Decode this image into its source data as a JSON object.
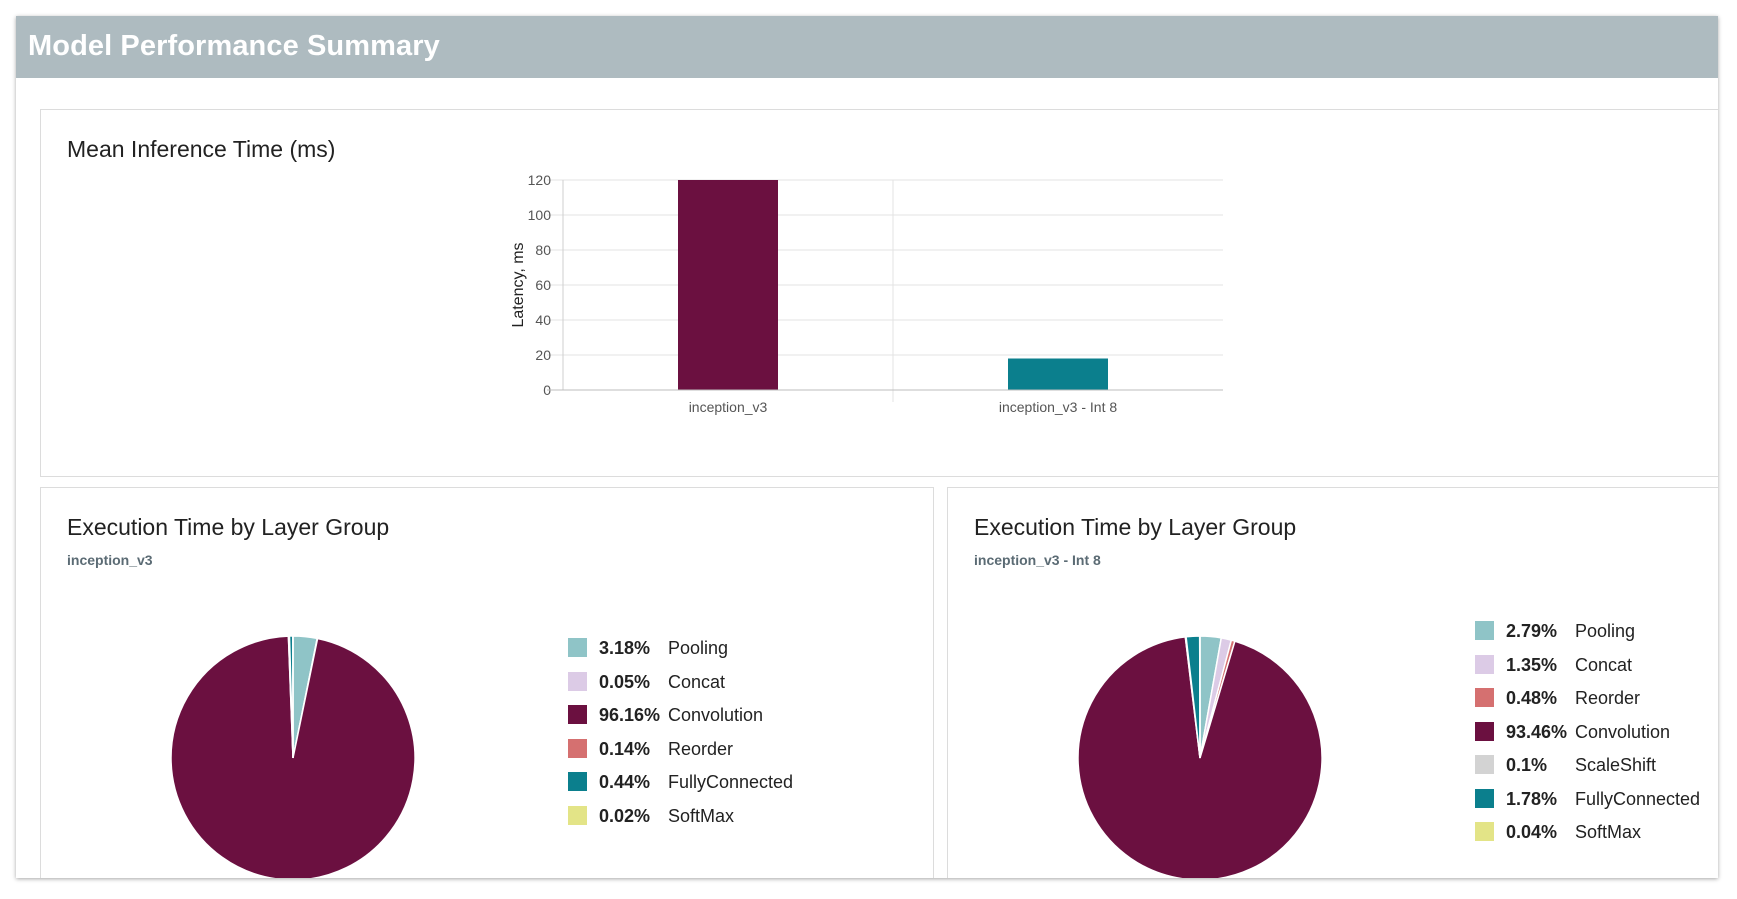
{
  "header": {
    "title": "Model Performance Summary"
  },
  "bar_card": {
    "title": "Mean Inference Time (ms)"
  },
  "pie_left": {
    "title": "Execution Time by Layer Group",
    "subtitle": "inception_v3"
  },
  "pie_right": {
    "title": "Execution Time by Layer Group",
    "subtitle": "inception_v3 - Int 8"
  },
  "colors": {
    "header_bg": "#aebbc0",
    "Pooling": "#8fc4c7",
    "Concat": "#dccbe6",
    "Convolution": "#6b1040",
    "Reorder": "#d57070",
    "ScaleShift": "#d3d3d3",
    "FullyConnected": "#0b7f8d",
    "SoftMax": "#e3e487"
  },
  "chart_data": [
    {
      "type": "bar",
      "title": "Mean Inference Time (ms)",
      "categories": [
        "inception_v3",
        "inception_v3 - Int 8"
      ],
      "values": [
        120,
        18
      ],
      "bar_colors": [
        "#6b1040",
        "#0b7f8d"
      ],
      "xlabel": "",
      "ylabel": "Latency, ms",
      "ylim": [
        0,
        120
      ],
      "yticks": [
        0,
        20,
        40,
        60,
        80,
        100,
        120
      ],
      "grid": true
    },
    {
      "type": "pie",
      "title": "Execution Time by Layer Group",
      "subtitle": "inception_v3",
      "slices": [
        {
          "label": "Pooling",
          "value": 3.18,
          "display": "3.18%"
        },
        {
          "label": "Concat",
          "value": 0.05,
          "display": "0.05%"
        },
        {
          "label": "Convolution",
          "value": 96.16,
          "display": "96.16%"
        },
        {
          "label": "Reorder",
          "value": 0.14,
          "display": "0.14%"
        },
        {
          "label": "FullyConnected",
          "value": 0.44,
          "display": "0.44%"
        },
        {
          "label": "SoftMax",
          "value": 0.02,
          "display": "0.02%"
        }
      ],
      "legend": "right"
    },
    {
      "type": "pie",
      "title": "Execution Time by Layer Group",
      "subtitle": "inception_v3 - Int 8",
      "slices": [
        {
          "label": "Pooling",
          "value": 2.79,
          "display": "2.79%"
        },
        {
          "label": "Concat",
          "value": 1.35,
          "display": "1.35%"
        },
        {
          "label": "Reorder",
          "value": 0.48,
          "display": "0.48%"
        },
        {
          "label": "Convolution",
          "value": 93.46,
          "display": "93.46%"
        },
        {
          "label": "ScaleShift",
          "value": 0.1,
          "display": "0.1%"
        },
        {
          "label": "FullyConnected",
          "value": 1.78,
          "display": "1.78%"
        },
        {
          "label": "SoftMax",
          "value": 0.04,
          "display": "0.04%"
        }
      ],
      "legend": "right"
    }
  ]
}
